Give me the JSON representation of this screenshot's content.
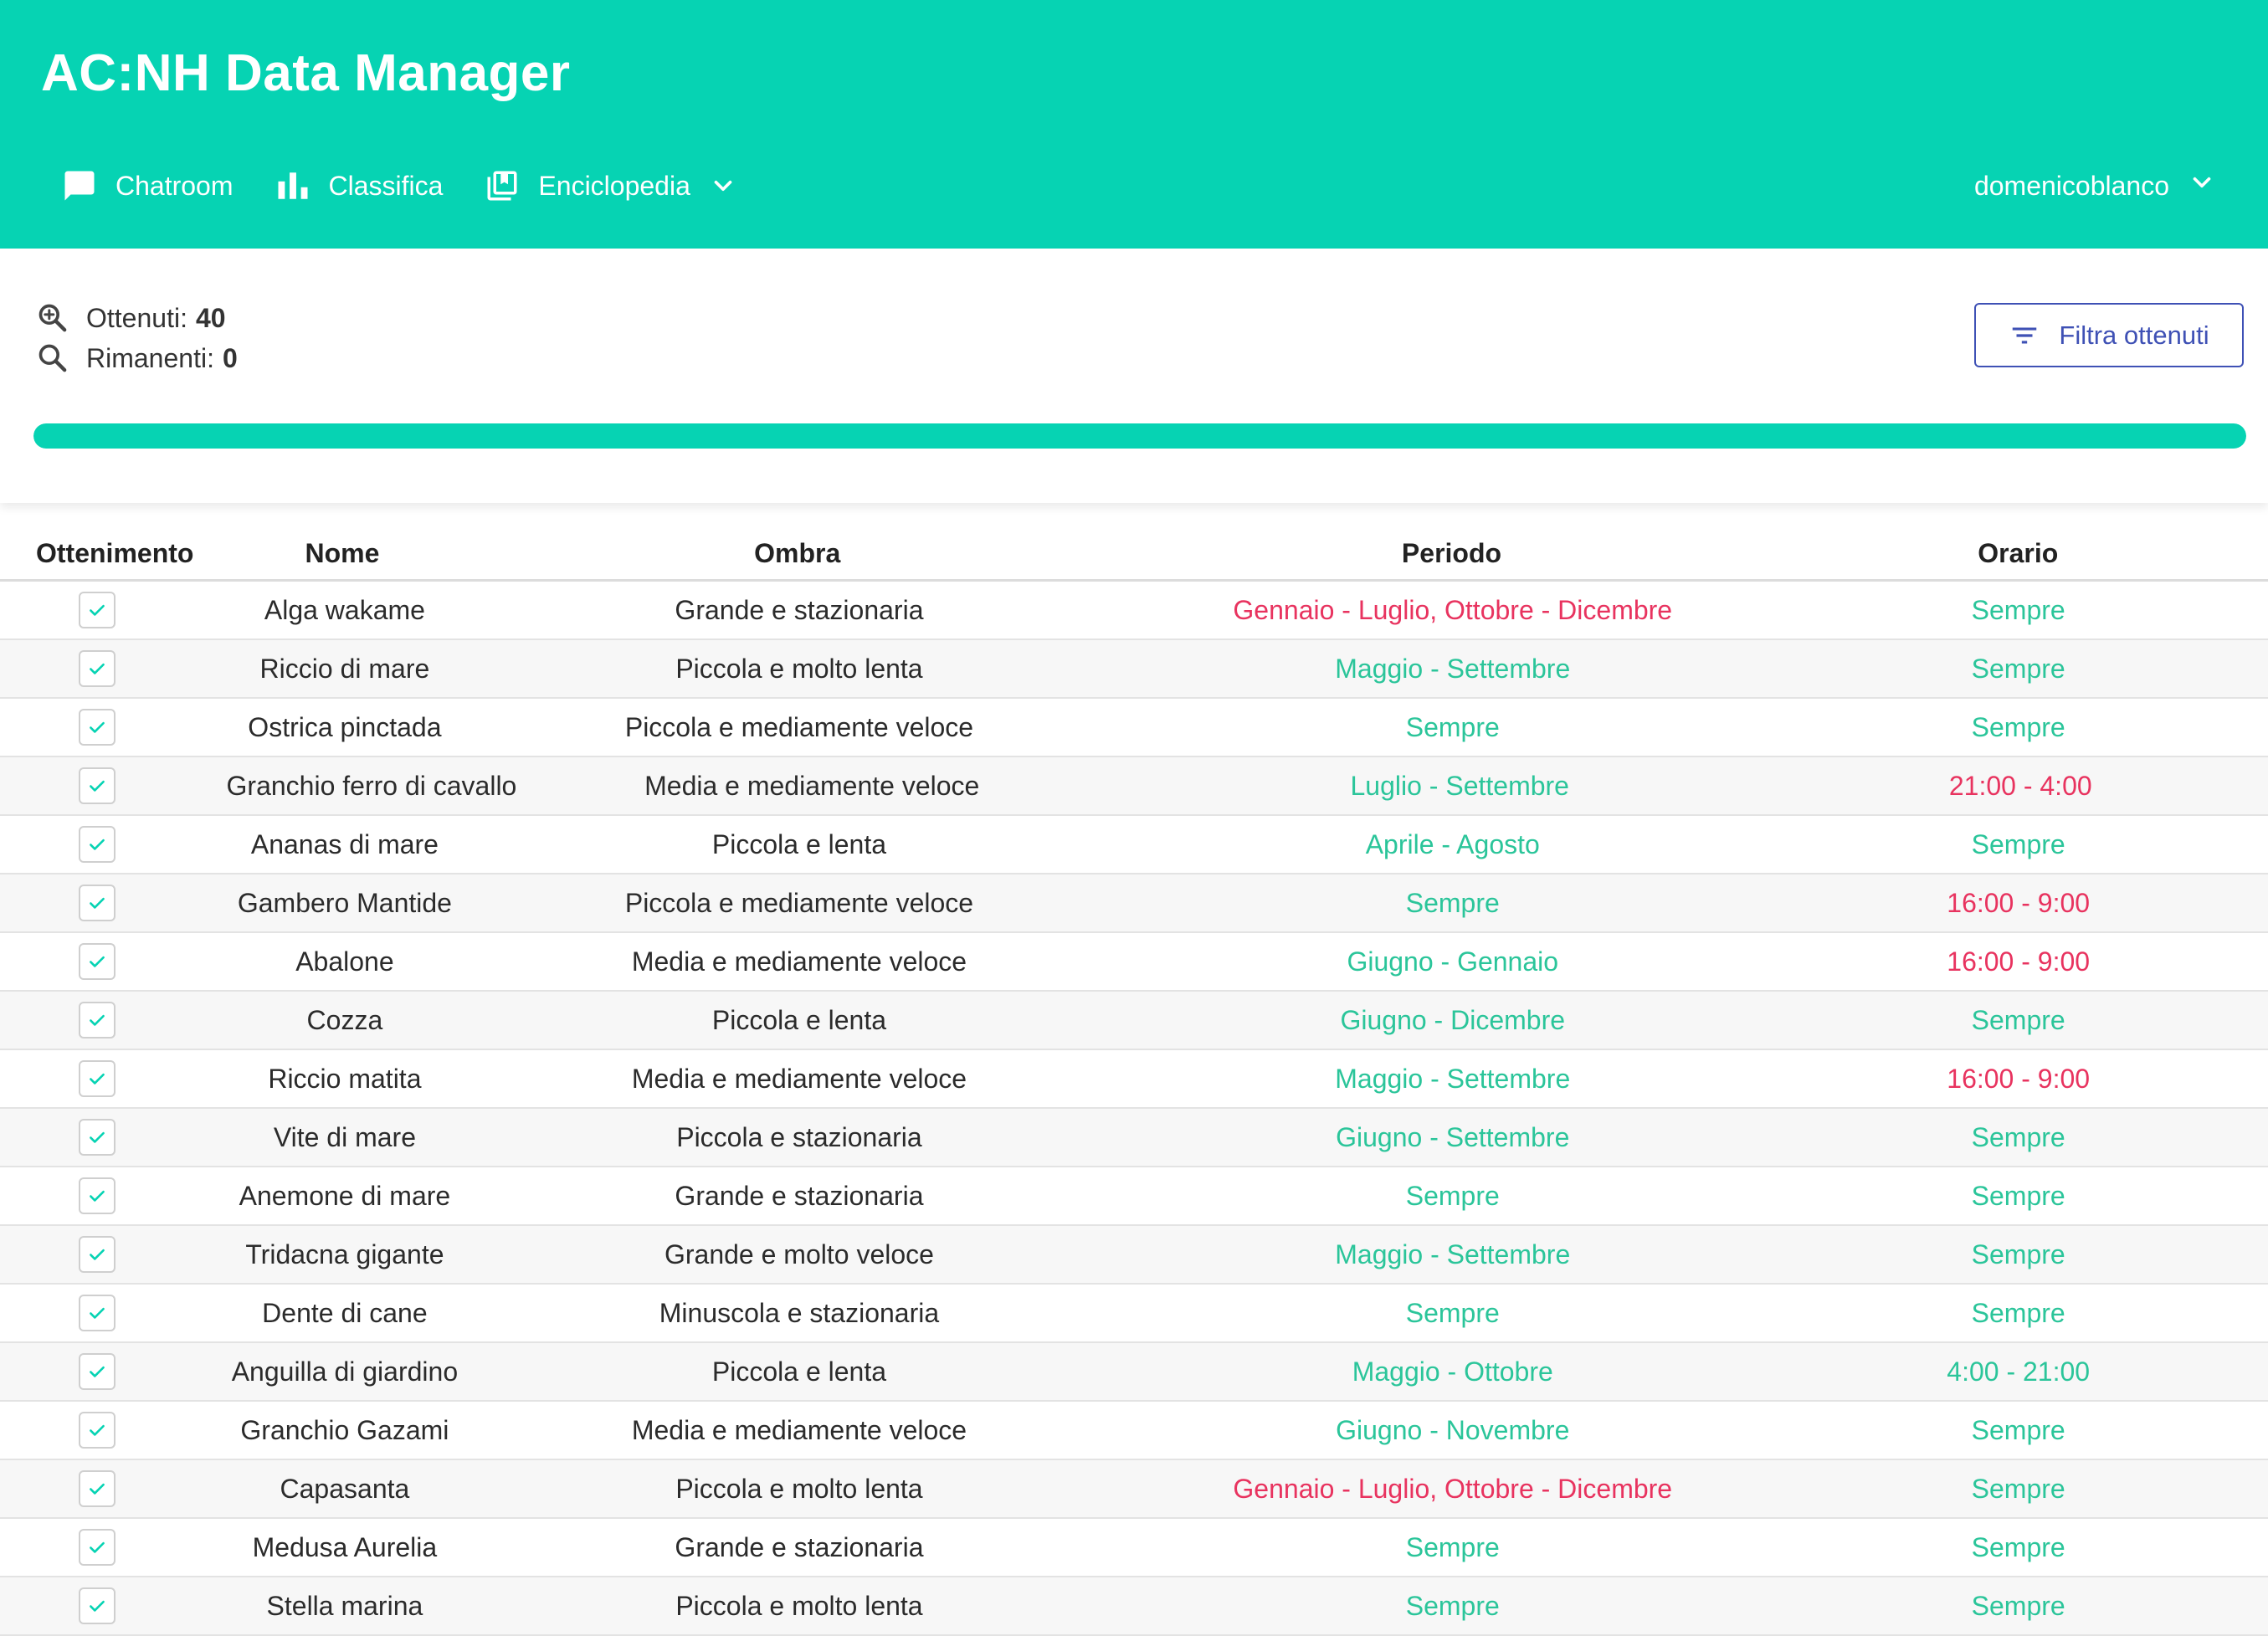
{
  "app": {
    "title": "AC:NH Data Manager"
  },
  "nav": {
    "items": [
      {
        "label": "Chatroom",
        "icon": "chat-icon"
      },
      {
        "label": "Classifica",
        "icon": "bar-chart-icon"
      },
      {
        "label": "Enciclopedia",
        "icon": "library-icon",
        "has_dropdown": true
      }
    ],
    "user": {
      "label": "domenicoblanco",
      "has_dropdown": true
    }
  },
  "summary": {
    "obtained_label": "Ottenuti:",
    "obtained_value": "40",
    "remaining_label": "Rimanenti:",
    "remaining_value": "0",
    "filter_button_label": "Filtra ottenuti",
    "progress_fraction": 1.0
  },
  "colors": {
    "header": "#06d3b3",
    "available": "#2bc59a",
    "unavailable": "#e8335f",
    "accent": "#3f51b5"
  },
  "table": {
    "headers": [
      "Ottenimento",
      "Nome",
      "Ombra",
      "Periodo",
      "Orario"
    ],
    "rows": [
      {
        "checked": true,
        "name": "Alga wakame",
        "shadow": "Grande e stazionaria",
        "period": "Gennaio - Luglio, Ottobre - Dicembre",
        "period_status": "red",
        "time": "Sempre",
        "time_status": "green"
      },
      {
        "checked": true,
        "name": "Riccio di mare",
        "shadow": "Piccola e molto lenta",
        "period": "Maggio - Settembre",
        "period_status": "green",
        "time": "Sempre",
        "time_status": "green"
      },
      {
        "checked": true,
        "name": "Ostrica pinctada",
        "shadow": "Piccola e mediamente veloce",
        "period": "Sempre",
        "period_status": "green",
        "time": "Sempre",
        "time_status": "green"
      },
      {
        "checked": true,
        "name": "Granchio ferro di cavallo",
        "shadow": "Media e mediamente veloce",
        "period": "Luglio - Settembre",
        "period_status": "green",
        "time": "21:00 - 4:00",
        "time_status": "red"
      },
      {
        "checked": true,
        "name": "Ananas di mare",
        "shadow": "Piccola e lenta",
        "period": "Aprile - Agosto",
        "period_status": "green",
        "time": "Sempre",
        "time_status": "green"
      },
      {
        "checked": true,
        "name": "Gambero Mantide",
        "shadow": "Piccola e mediamente veloce",
        "period": "Sempre",
        "period_status": "green",
        "time": "16:00 - 9:00",
        "time_status": "red"
      },
      {
        "checked": true,
        "name": "Abalone",
        "shadow": "Media e mediamente veloce",
        "period": "Giugno - Gennaio",
        "period_status": "green",
        "time": "16:00 - 9:00",
        "time_status": "red"
      },
      {
        "checked": true,
        "name": "Cozza",
        "shadow": "Piccola e lenta",
        "period": "Giugno - Dicembre",
        "period_status": "green",
        "time": "Sempre",
        "time_status": "green"
      },
      {
        "checked": true,
        "name": "Riccio matita",
        "shadow": "Media e mediamente veloce",
        "period": "Maggio - Settembre",
        "period_status": "green",
        "time": "16:00 - 9:00",
        "time_status": "red"
      },
      {
        "checked": true,
        "name": "Vite di mare",
        "shadow": "Piccola e stazionaria",
        "period": "Giugno - Settembre",
        "period_status": "green",
        "time": "Sempre",
        "time_status": "green"
      },
      {
        "checked": true,
        "name": "Anemone di mare",
        "shadow": "Grande e stazionaria",
        "period": "Sempre",
        "period_status": "green",
        "time": "Sempre",
        "time_status": "green"
      },
      {
        "checked": true,
        "name": "Tridacna gigante",
        "shadow": "Grande e molto veloce",
        "period": "Maggio - Settembre",
        "period_status": "green",
        "time": "Sempre",
        "time_status": "green"
      },
      {
        "checked": true,
        "name": "Dente di cane",
        "shadow": "Minuscola e stazionaria",
        "period": "Sempre",
        "period_status": "green",
        "time": "Sempre",
        "time_status": "green"
      },
      {
        "checked": true,
        "name": "Anguilla di giardino",
        "shadow": "Piccola e lenta",
        "period": "Maggio - Ottobre",
        "period_status": "green",
        "time": "4:00 - 21:00",
        "time_status": "green"
      },
      {
        "checked": true,
        "name": "Granchio Gazami",
        "shadow": "Media e mediamente veloce",
        "period": "Giugno - Novembre",
        "period_status": "green",
        "time": "Sempre",
        "time_status": "green"
      },
      {
        "checked": true,
        "name": "Capasanta",
        "shadow": "Piccola e molto lenta",
        "period": "Gennaio - Luglio, Ottobre - Dicembre",
        "period_status": "red",
        "time": "Sempre",
        "time_status": "green"
      },
      {
        "checked": true,
        "name": "Medusa Aurelia",
        "shadow": "Grande e stazionaria",
        "period": "Sempre",
        "period_status": "green",
        "time": "Sempre",
        "time_status": "green"
      },
      {
        "checked": true,
        "name": "Stella marina",
        "shadow": "Piccola e molto lenta",
        "period": "Sempre",
        "period_status": "green",
        "time": "Sempre",
        "time_status": "green"
      }
    ]
  }
}
